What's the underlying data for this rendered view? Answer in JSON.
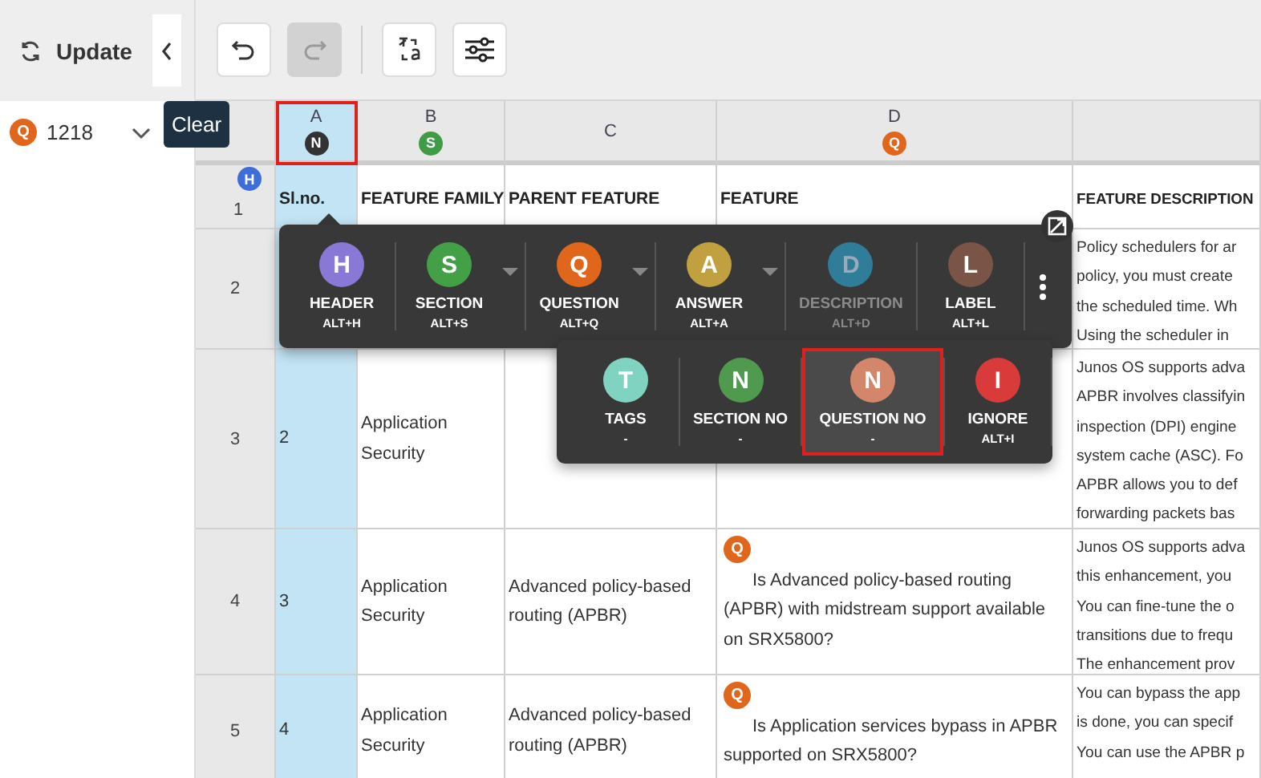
{
  "left_panel": {
    "update_button": "Update",
    "tooltip": "Clear",
    "question_badge": {
      "letter": "Q",
      "color": "#e0661b"
    },
    "count": "1218"
  },
  "toolbar": {
    "buttons": [
      {
        "kind": "undo",
        "disabled": false
      },
      {
        "kind": "redo",
        "disabled": true
      },
      {
        "kind": "translate",
        "disabled": false
      },
      {
        "kind": "settings",
        "disabled": false
      }
    ]
  },
  "sheet": {
    "columns": [
      {
        "letter": "A",
        "selected": true,
        "badge": {
          "letter": "N",
          "color": "#333333"
        }
      },
      {
        "letter": "B",
        "selected": false,
        "badge": {
          "letter": "S",
          "color": "#3f9b45"
        }
      },
      {
        "letter": "C",
        "selected": false
      },
      {
        "letter": "D",
        "selected": false,
        "badge": {
          "letter": "Q",
          "color": "#e0661b"
        }
      },
      {
        "selected": false
      }
    ],
    "rows": [
      {
        "number": "1",
        "badge": {
          "letter": "H",
          "color": "#3e6fd8"
        },
        "kind": "header",
        "cells": [
          {
            "lines": [
              "Sl.no."
            ]
          },
          {
            "lines": [
              "FEATURE FAMILY"
            ]
          },
          {
            "lines": [
              "PARENT FEATURE"
            ]
          },
          {
            "lines": [
              "FEATURE"
            ]
          },
          {
            "lines": [
              "FEATURE DESCRIPTION"
            ]
          }
        ]
      },
      {
        "number": "2",
        "kind": "data",
        "cells": [
          {},
          {},
          {},
          {},
          {
            "lines": [
              "Policy schedulers for ar",
              "policy, you must create",
              "the scheduled time. Wh",
              "Using the scheduler in"
            ]
          }
        ]
      },
      {
        "number": "3",
        "kind": "data",
        "cells": [
          {
            "lines": [
              "2"
            ]
          },
          {
            "lines": [
              "Application",
              "Security"
            ]
          },
          {},
          {},
          {
            "lines": [
              "Junos OS supports adva",
              "APBR involves classifyin",
              "inspection (DPI) engine",
              "system cache (ASC). Fo",
              "APBR allows you to def",
              "forwarding packets bas"
            ]
          }
        ]
      },
      {
        "number": "4",
        "kind": "data",
        "cells": [
          {
            "lines": [
              "3"
            ]
          },
          {
            "lines": [
              "Application",
              "Security"
            ]
          },
          {
            "lines": [
              "Advanced policy-based",
              "routing (APBR)"
            ]
          },
          {
            "badge": {
              "letter": "Q",
              "color": "#e0661b"
            },
            "text": "Is Advanced policy-based routing (APBR) with midstream support available on SRX5800?"
          },
          {
            "lines": [
              "Junos OS supports adva",
              "this enhancement, you",
              "You can fine-tune the o",
              "transitions due to frequ",
              "The enhancement prov"
            ]
          }
        ]
      },
      {
        "number": "5",
        "kind": "data",
        "cells": [
          {
            "lines": [
              "4"
            ]
          },
          {
            "lines": [
              "Application",
              "Security"
            ]
          },
          {
            "lines": [
              "Advanced policy-based",
              "routing (APBR)"
            ]
          },
          {
            "badge": {
              "letter": "Q",
              "color": "#e0661b"
            },
            "text": "Is Application services bypass in APBR supported on SRX5800?"
          },
          {
            "lines": [
              "You can bypass the app",
              "is done, you can specif",
              "You can use the APBR p"
            ]
          }
        ]
      }
    ]
  },
  "tag_menu": {
    "primary": [
      {
        "letter": "H",
        "label": "HEADER",
        "shortcut": "ALT+H",
        "color": "#8a78d6",
        "disabled": false,
        "selected": false,
        "dropdown": false
      },
      {
        "letter": "S",
        "label": "SECTION",
        "shortcut": "ALT+S",
        "color": "#43a047",
        "disabled": false,
        "selected": false,
        "dropdown": true
      },
      {
        "letter": "Q",
        "label": "QUESTION",
        "shortcut": "ALT+Q",
        "color": "#e0661b",
        "disabled": false,
        "selected": false,
        "dropdown": true
      },
      {
        "letter": "A",
        "label": "ANSWER",
        "shortcut": "ALT+A",
        "color": "#c1a03f",
        "disabled": false,
        "selected": false,
        "dropdown": true
      },
      {
        "letter": "D",
        "label": "DESCRIPTION",
        "shortcut": "ALT+D",
        "color": "#2f7d99",
        "disabled": true,
        "selected": false,
        "dropdown": false
      },
      {
        "letter": "L",
        "label": "LABEL",
        "shortcut": "ALT+L",
        "color": "#7a5446",
        "disabled": false,
        "selected": false,
        "dropdown": false
      }
    ],
    "secondary": [
      {
        "letter": "T",
        "label": "TAGS",
        "shortcut": "-",
        "color": "#7fd3c0",
        "disabled": false,
        "selected": false,
        "dropdown": false
      },
      {
        "letter": "N",
        "label": "SECTION NO",
        "shortcut": "-",
        "color": "#4f9a4f",
        "disabled": false,
        "selected": false,
        "dropdown": false
      },
      {
        "letter": "N",
        "label": "QUESTION NO",
        "shortcut": "-",
        "color": "#d4866a",
        "disabled": false,
        "selected": true,
        "dropdown": false
      },
      {
        "letter": "I",
        "label": "IGNORE",
        "shortcut": "ALT+I",
        "color": "#d93b3b",
        "disabled": false,
        "selected": false,
        "dropdown": false
      }
    ]
  }
}
